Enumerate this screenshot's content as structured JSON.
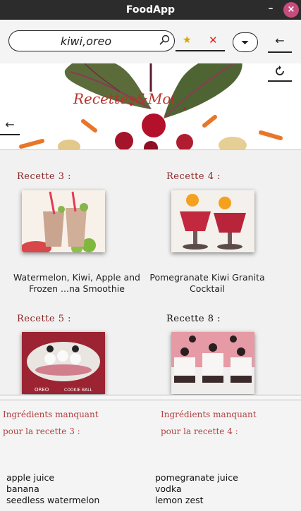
{
  "window": {
    "title": "FoodApp",
    "minimize": "–",
    "close": "×"
  },
  "search": {
    "value": "kiwi,oreo"
  },
  "icons": {
    "search": "magnifier-icon",
    "favorite": "star-icon",
    "clear": "close-icon",
    "dropdown": "chevron-down-icon",
    "back": "arrow-left-icon",
    "refresh": "refresh-icon"
  },
  "toolbar": {
    "star": "★",
    "clear": "✕",
    "back": "←"
  },
  "banner": {
    "logo_text": "Recettes&Moi",
    "back": "←"
  },
  "recipes": [
    {
      "label": "Recette 3 :",
      "title": "Watermelon, Kiwi, Apple and Frozen ...na Smoothie"
    },
    {
      "label": "Recette 4 :",
      "title": "Pomegranate Kiwi Granita Cocktail"
    },
    {
      "label": "Recette 5 :",
      "title": ""
    },
    {
      "label": "Recette 8 :",
      "title": ""
    }
  ],
  "thumb_text": {
    "oreo": "OREO",
    "cookie_ball": "COOKIE BALL"
  },
  "ingredients": [
    {
      "heading_1": "Ingrédients manquant",
      "heading_2": "pour la recette 3 :",
      "items": [
        "apple juice",
        "banana",
        "seedless watermelon"
      ]
    },
    {
      "heading_1": "Ingrédients manquant",
      "heading_2": "pour la recette 4 :",
      "items": [
        "pomegranate juice",
        "vodka",
        "lemon zest"
      ]
    }
  ],
  "colors": {
    "accent_red": "#b9322a",
    "titlebar": "#2c2c2c",
    "close_button": "#c54c7d",
    "star": "#d6a300"
  }
}
